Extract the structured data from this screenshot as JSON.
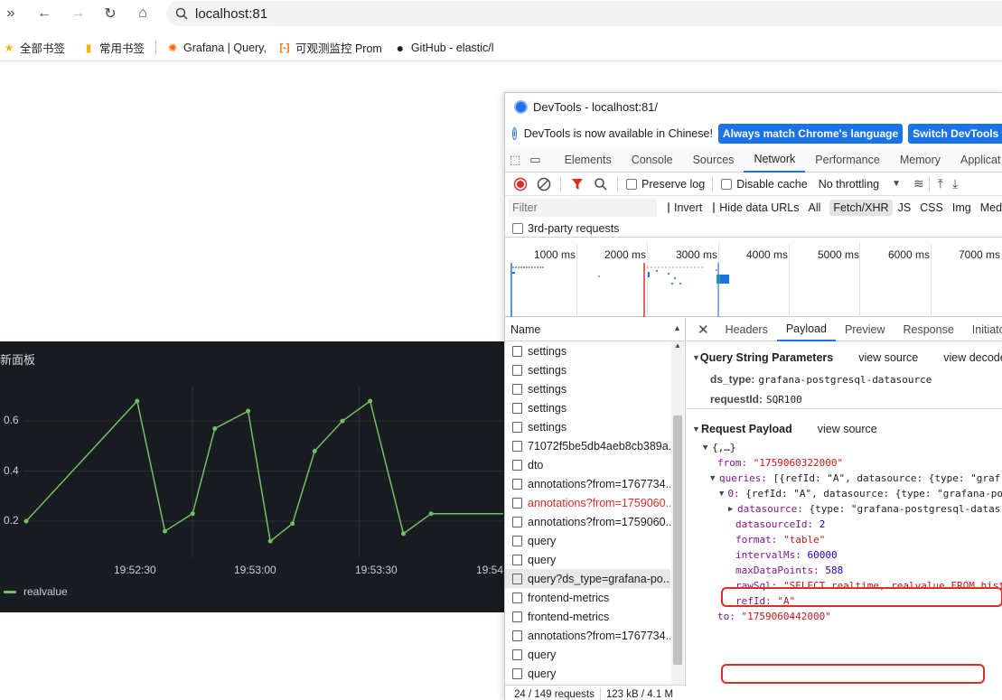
{
  "browser": {
    "url": "localhost:81",
    "bookmarks": [
      {
        "label": "全部书签",
        "icon": "star-icon"
      },
      {
        "label": "常用书签",
        "icon": "bookmark-folder-icon"
      },
      {
        "label": "Grafana | Query,",
        "icon": "grafana-icon"
      },
      {
        "label": "可观测监控 Prom",
        "icon": "bracket-icon"
      },
      {
        "label": "GitHub - elastic/l",
        "icon": "github-icon"
      }
    ]
  },
  "panel": {
    "title": "新面板",
    "legend": "realvalue",
    "colors": {
      "background": "#181b1f",
      "series": "#73bf69"
    }
  },
  "chart_data": {
    "type": "line",
    "title": "新面板",
    "xlabel": "",
    "ylabel": "",
    "x_tick_labels": [
      "19:52:30",
      "19:53:00",
      "19:53:30",
      "19:54"
    ],
    "y_tick_labels": [
      "0.2",
      "0.4",
      "0.6"
    ],
    "ylim": [
      0.1,
      0.75
    ],
    "x_unit": "seconds after 19:52:00",
    "series": [
      {
        "name": "realvalue",
        "x": [
          0,
          20,
          25,
          30,
          34,
          40,
          44,
          48,
          52,
          57,
          62,
          68,
          73,
          86
        ],
        "y": [
          0.2,
          0.68,
          0.16,
          0.23,
          0.57,
          0.64,
          0.12,
          0.19,
          0.48,
          0.6,
          0.68,
          0.15,
          0.23,
          0.23
        ]
      }
    ],
    "grid": true,
    "legend_position": "bottom-left"
  },
  "devtools": {
    "title": "DevTools - localhost:81/",
    "info": "DevTools is now available in Chinese!",
    "btn_match": "Always match Chrome's language",
    "btn_switch": "Switch DevTools to Ch",
    "tabs": [
      "Elements",
      "Console",
      "Sources",
      "Network",
      "Performance",
      "Memory",
      "Applicat"
    ],
    "toolbar": {
      "preserve_log": "Preserve log",
      "disable_cache": "Disable cache",
      "throttling": "No throttling"
    },
    "filter": {
      "placeholder": "Filter",
      "invert": "Invert",
      "hide_data_urls": "Hide data URLs",
      "types": [
        "All",
        "Fetch/XHR",
        "JS",
        "CSS",
        "Img",
        "Medi"
      ],
      "third_party": "3rd-party requests"
    },
    "overview_ticks": [
      "1000 ms",
      "2000 ms",
      "3000 ms",
      "4000 ms",
      "5000 ms",
      "6000 ms",
      "7000 ms"
    ],
    "name_header": "Name",
    "requests": [
      {
        "name": "settings",
        "error": false
      },
      {
        "name": "settings",
        "error": false
      },
      {
        "name": "settings",
        "error": false
      },
      {
        "name": "settings",
        "error": false
      },
      {
        "name": "settings",
        "error": false
      },
      {
        "name": "71072f5be5db4aeb8cb389a...",
        "error": false
      },
      {
        "name": "dto",
        "error": false
      },
      {
        "name": "annotations?from=1767734...",
        "error": false
      },
      {
        "name": "annotations?from=1759060...",
        "error": true
      },
      {
        "name": "annotations?from=1759060...",
        "error": false
      },
      {
        "name": "query",
        "error": false
      },
      {
        "name": "query",
        "error": false
      },
      {
        "name": "query?ds_type=grafana-po...",
        "error": false,
        "selected": true
      },
      {
        "name": "frontend-metrics",
        "error": false
      },
      {
        "name": "frontend-metrics",
        "error": false
      },
      {
        "name": "annotations?from=1767734...",
        "error": false
      },
      {
        "name": "query",
        "error": false
      },
      {
        "name": "query",
        "error": false
      }
    ],
    "status": "24 / 149 requests",
    "status_size": "123 kB / 4.1 M",
    "detail_tabs": [
      "Headers",
      "Payload",
      "Preview",
      "Response",
      "Initiator"
    ],
    "query_string": {
      "heading": "Query String Parameters",
      "view_source": "view source",
      "view_decoded": "view decoded",
      "params": [
        {
          "key": "ds_type:",
          "value": "grafana-postgresql-datasource"
        },
        {
          "key": "requestId:",
          "value": "SQR100"
        }
      ]
    },
    "request_payload": {
      "heading": "Request Payload",
      "view_source": "view source",
      "root": "{,…}",
      "from_key": "from:",
      "from_val": "\"1759060322000\"",
      "queries_key": "queries:",
      "queries_val": "[{refId: \"A\", datasource: {type: \"graf",
      "q0_key": "0:",
      "q0_val": "{refId: \"A\", datasource: {type: \"grafana-po",
      "ds_key": "datasource:",
      "ds_val": "{type: \"grafana-postgresql-datas",
      "dsid_key": "datasourceId:",
      "dsid_val": "2",
      "format_key": "format:",
      "format_val": "\"table\"",
      "interval_key": "intervalMs:",
      "interval_val": "60000",
      "maxdp_key": "maxDataPoints:",
      "maxdp_val": "588",
      "rawsql_key": "rawSql:",
      "rawsql_val": "\"SELECT realtime, realvalue FROM hist",
      "refid_key": "refId:",
      "refid_val": "\"A\"",
      "to_key": "to:",
      "to_val": "\"1759060442000\""
    }
  }
}
